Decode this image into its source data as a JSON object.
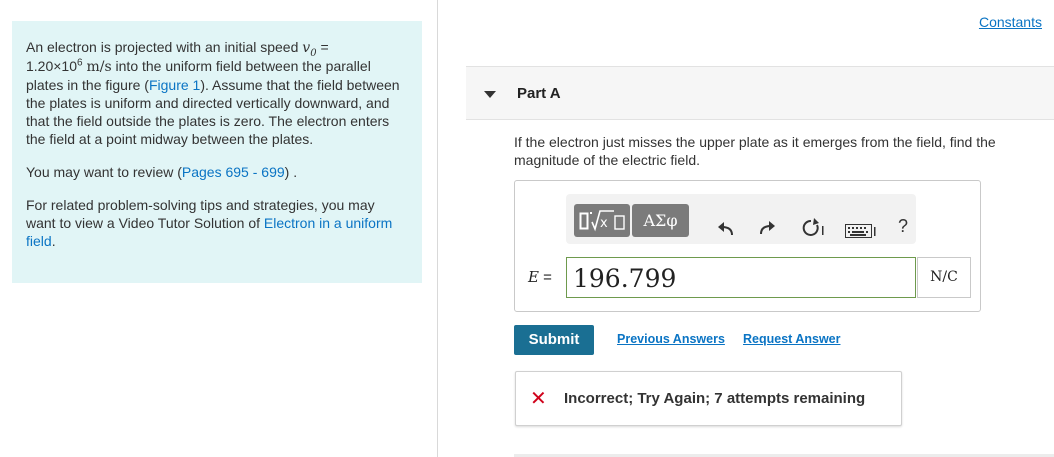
{
  "intro": {
    "line1_pre": "An electron is projected with an initial speed ",
    "v0_symbol": "v",
    "v0_sub": "0",
    "eq": " =",
    "speed_value": "1.20×10",
    "speed_exp": "6",
    "speed_unit": "m/s",
    "line1_post": " into the uniform field between the parallel plates in the figure (",
    "figure_link": "Figure 1",
    "line1_end": "). Assume that the field between the plates is uniform and directed vertically downward, and that the field outside the plates is zero. The electron enters the field at a point midway between the plates.",
    "review_pre": "You may want to review (",
    "review_link": "Pages 695 - 699",
    "review_post": ") .",
    "related_pre": "For related problem-solving tips and strategies, you may want to view a Video Tutor Solution of ",
    "related_link": "Electron in a uniform field",
    "related_post": "."
  },
  "header": {
    "constants_label": "Constants"
  },
  "part": {
    "title": "Part A"
  },
  "question": "If the electron just misses the upper plate as it emerges from the field, find the magnitude of the electric field.",
  "toolbar": {
    "greek_label": "ΑΣφ",
    "help_label": "?",
    "icons": [
      "templates-icon",
      "greek-symbols-icon",
      "undo-icon",
      "redo-icon",
      "reset-icon",
      "keyboard-icon",
      "help-icon"
    ]
  },
  "answer": {
    "variable": "E",
    "equals": "=",
    "value": "196.799",
    "units": "N/C"
  },
  "actions": {
    "submit_label": "Submit",
    "previous_answers_label": "Previous Answers",
    "request_answer_label": "Request Answer"
  },
  "feedback": {
    "message": "Incorrect; Try Again; 7 attempts remaining"
  },
  "colors": {
    "intro_bg": "#e1f5f6",
    "link": "#0a74c4",
    "submit_bg": "#1a6f93",
    "error_red": "#d0021b"
  }
}
